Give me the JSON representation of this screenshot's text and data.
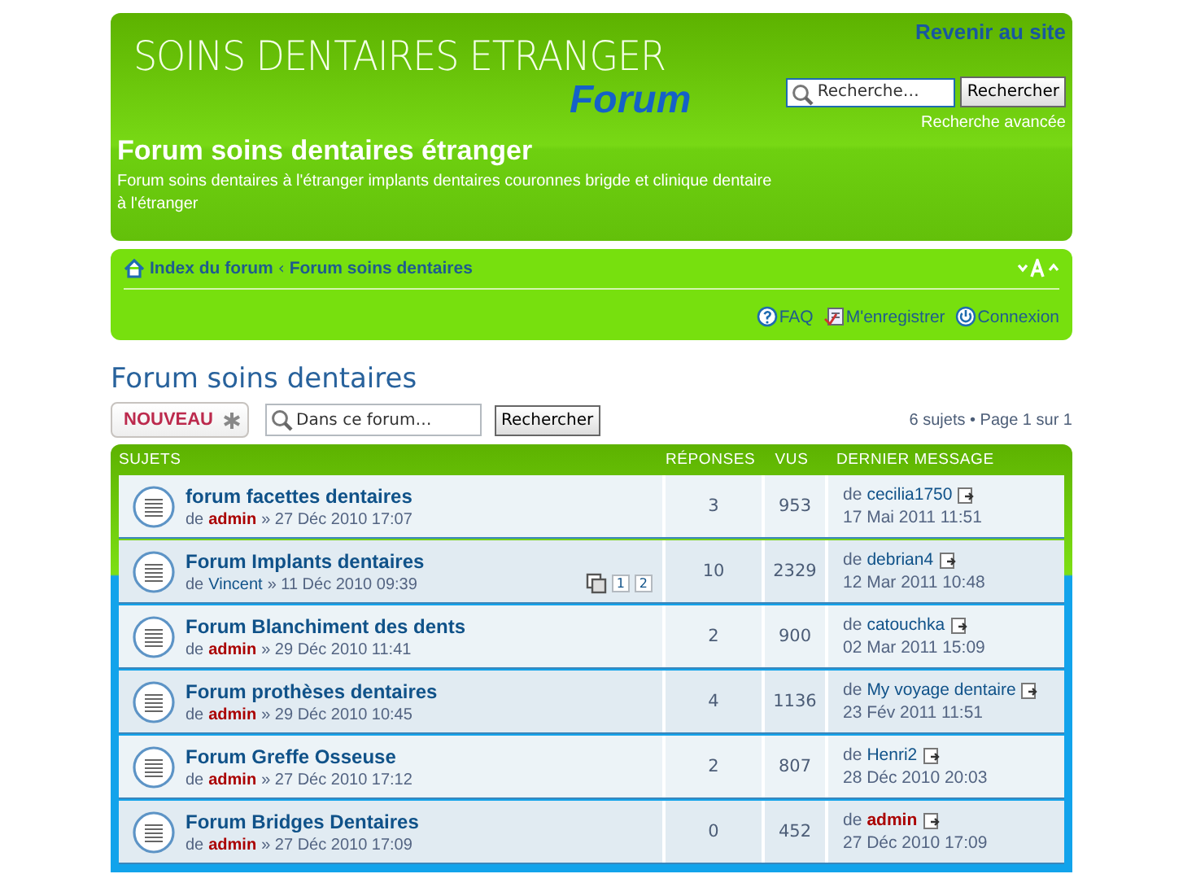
{
  "header": {
    "logo_title": "SOINS DENTAIRES ETRANGER",
    "logo_subtitle": "Forum",
    "site_title": "Forum soins dentaires étranger",
    "description": "Forum soins dentaires à l'étranger implants dentaires couronnes brigde et clinique dentaire à l'étranger",
    "back_link": "Revenir au site",
    "search": {
      "placeholder": "Recherche…",
      "button": "Rechercher",
      "advanced": "Recherche avancée"
    }
  },
  "navbar": {
    "breadcrumbs": [
      "Index du forum",
      "Forum soins dentaires"
    ],
    "separator": "‹",
    "links": [
      {
        "label": "FAQ",
        "kind": "faq"
      },
      {
        "label": "M'enregistrer",
        "kind": "register"
      },
      {
        "label": "Connexion",
        "kind": "login"
      }
    ]
  },
  "page_title": "Forum soins dentaires",
  "actions": {
    "new_button": "NOUVEAU",
    "search_placeholder": "Dans ce forum…",
    "search_button": "Rechercher",
    "pagination": "6 sujets • Page 1 sur 1"
  },
  "table": {
    "columns": [
      "SUJETS",
      "RÉPONSES",
      "VUS",
      "DERNIER MESSAGE"
    ],
    "rows": [
      {
        "title": "forum facettes dentaires",
        "by": "de",
        "author": "admin",
        "author_is_admin": true,
        "date": "» 27 Déc 2010 17:07",
        "pages": [],
        "replies": "3",
        "views": "953",
        "last_by": "de",
        "last_author": "cecilia1750",
        "last_author_is_admin": false,
        "last_date": "17 Mai 2011 11:51"
      },
      {
        "title": "Forum Implants dentaires",
        "by": "de",
        "author": "Vincent",
        "author_is_admin": false,
        "date": "» 11 Déc 2010 09:39",
        "pages": [
          "1",
          "2"
        ],
        "replies": "10",
        "views": "2329",
        "last_by": "de",
        "last_author": "debrian4",
        "last_author_is_admin": false,
        "last_date": "12 Mar 2011 10:48"
      },
      {
        "title": "Forum Blanchiment des dents",
        "by": "de",
        "author": "admin",
        "author_is_admin": true,
        "date": "» 29 Déc 2010 11:41",
        "pages": [],
        "replies": "2",
        "views": "900",
        "last_by": "de",
        "last_author": "catouchka",
        "last_author_is_admin": false,
        "last_date": "02 Mar 2011 15:09"
      },
      {
        "title": "Forum prothèses dentaires",
        "by": "de",
        "author": "admin",
        "author_is_admin": true,
        "date": "» 29 Déc 2010 10:45",
        "pages": [],
        "replies": "4",
        "views": "1136",
        "last_by": "de",
        "last_author": "My voyage dentaire",
        "last_author_is_admin": false,
        "last_date": "23 Fév 2011 11:51"
      },
      {
        "title": "Forum Greffe Osseuse",
        "by": "de",
        "author": "admin",
        "author_is_admin": true,
        "date": "» 27 Déc 2010 17:12",
        "pages": [],
        "replies": "2",
        "views": "807",
        "last_by": "de",
        "last_author": "Henri2",
        "last_author_is_admin": false,
        "last_date": "28 Déc 2010 20:03"
      },
      {
        "title": "Forum Bridges Dentaires",
        "by": "de",
        "author": "admin",
        "author_is_admin": true,
        "date": "» 27 Déc 2010 17:09",
        "pages": [],
        "replies": "0",
        "views": "452",
        "last_by": "de",
        "last_author": "admin",
        "last_author_is_admin": true,
        "last_date": "27 Déc 2010 17:09"
      }
    ]
  }
}
